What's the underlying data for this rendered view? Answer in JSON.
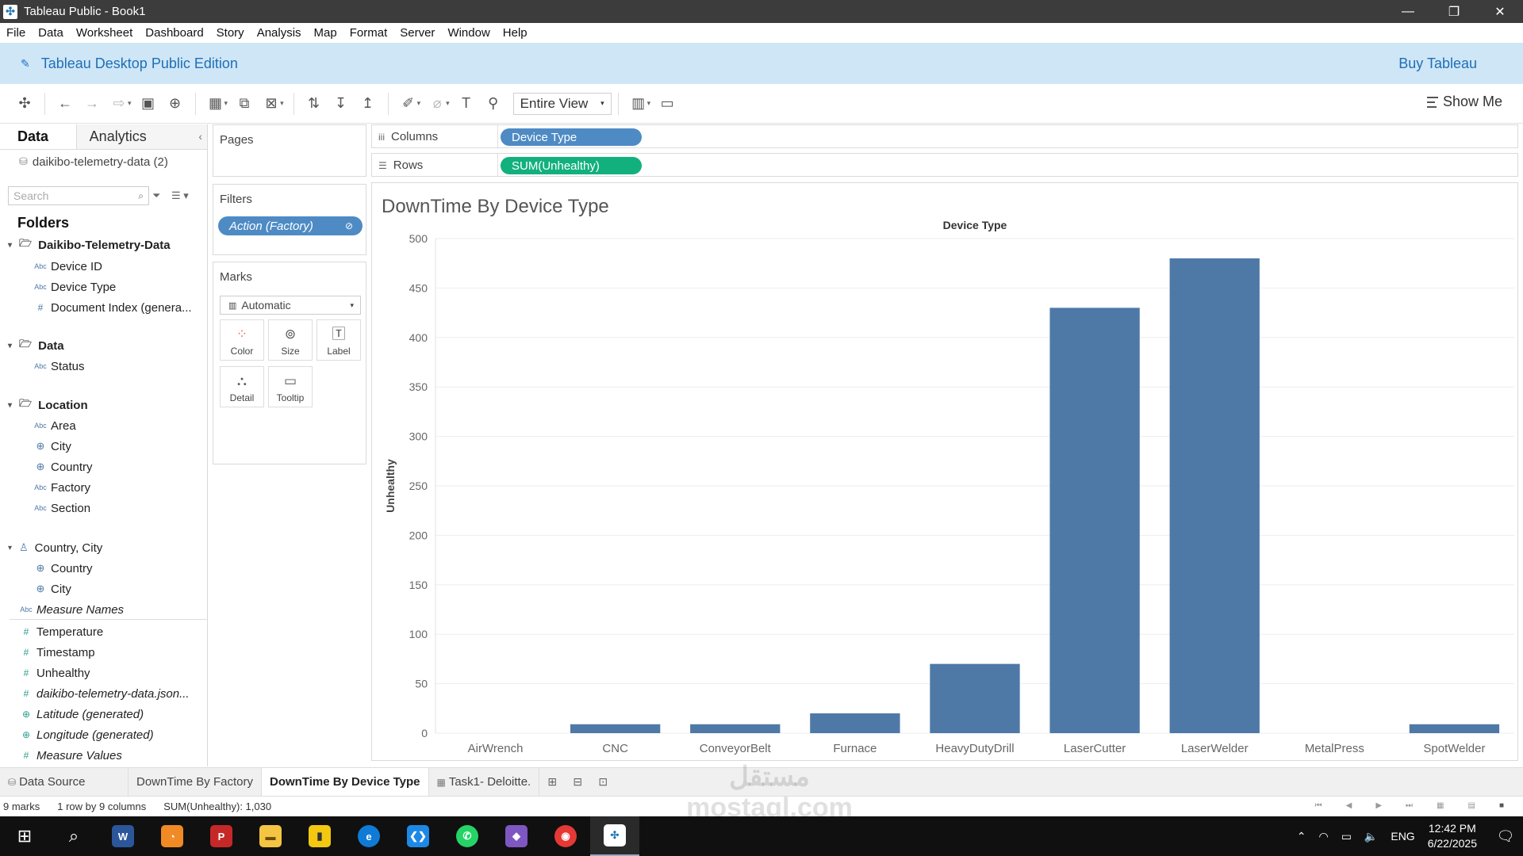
{
  "window": {
    "title": "Tableau Public - Book1",
    "controls": [
      "minimize-icon",
      "restore-icon",
      "close-icon"
    ]
  },
  "menu": [
    "File",
    "Data",
    "Worksheet",
    "Dashboard",
    "Story",
    "Analysis",
    "Map",
    "Format",
    "Server",
    "Window",
    "Help"
  ],
  "banner": {
    "edition": "Tableau Desktop Public Edition",
    "buy": "Buy Tableau"
  },
  "toolbar": {
    "fit": "Entire View",
    "show_me": "Show Me"
  },
  "data_pane": {
    "tabs": [
      "Data",
      "Analytics"
    ],
    "source": "daikibo-telemetry-data (2)",
    "search_placeholder": "Search",
    "folders_label": "Folders",
    "groups": [
      {
        "name": "Daikibo-Telemetry-Data",
        "fields": [
          {
            "type": "Abc",
            "name": "Device ID"
          },
          {
            "type": "Abc",
            "name": "Device Type"
          },
          {
            "type": "#",
            "name": "Document Index (genera..."
          }
        ]
      },
      {
        "name": "Data",
        "fields": [
          {
            "type": "Abc",
            "name": "Status"
          }
        ]
      },
      {
        "name": "Location",
        "fields": [
          {
            "type": "Abc",
            "name": "Area"
          },
          {
            "type": "geo",
            "name": "City"
          },
          {
            "type": "geo",
            "name": "Country"
          },
          {
            "type": "Abc",
            "name": "Factory"
          },
          {
            "type": "Abc",
            "name": "Section"
          }
        ]
      },
      {
        "name": "Country, City",
        "fields": [
          {
            "type": "geo",
            "name": "Country"
          },
          {
            "type": "geo",
            "name": "City"
          }
        ]
      }
    ],
    "measure_names": "Measure Names",
    "measures": [
      {
        "name": "Temperature",
        "italic": false
      },
      {
        "name": "Timestamp",
        "italic": false
      },
      {
        "name": "Unhealthy",
        "italic": false
      },
      {
        "name": "daikibo-telemetry-data.json...",
        "italic": true
      },
      {
        "name": "Latitude (generated)",
        "italic": true
      },
      {
        "name": "Longitude (generated)",
        "italic": true
      },
      {
        "name": "Measure Values",
        "italic": true
      }
    ]
  },
  "cards": {
    "pages": "Pages",
    "filters": "Filters",
    "filter_pill": "Action (Factory)",
    "marks": "Marks",
    "mark_type": "Automatic",
    "mark_buttons": [
      "Color",
      "Size",
      "Label",
      "Detail",
      "Tooltip"
    ]
  },
  "shelves": {
    "columns_label": "Columns",
    "rows_label": "Rows",
    "columns_pill": "Device Type",
    "rows_pill": "SUM(Unhealthy)"
  },
  "viz": {
    "title": "DownTime By Device Type"
  },
  "chart_data": {
    "type": "bar",
    "title": "DownTime By Device Type",
    "header": "Device Type",
    "xlabel": "Device Type",
    "ylabel": "Unhealthy",
    "categories": [
      "AirWrench",
      "CNC",
      "ConveyorBelt",
      "Furnace",
      "HeavyDutyDrill",
      "LaserCutter",
      "LaserWelder",
      "MetalPress",
      "SpotWelder"
    ],
    "values": [
      0,
      9,
      9,
      20,
      70,
      430,
      480,
      0,
      9
    ],
    "ylim": [
      0,
      500
    ],
    "yticks": [
      0,
      50,
      100,
      150,
      200,
      250,
      300,
      350,
      400,
      450,
      500
    ],
    "color": "#4e79a7",
    "grid": true
  },
  "sheet_tabs": [
    {
      "label": "Data Source",
      "icon": "database-icon",
      "active": false
    },
    {
      "label": "DownTime By Factory",
      "icon": "",
      "active": false
    },
    {
      "label": "DownTime By Device Type",
      "icon": "",
      "active": true
    },
    {
      "label": "Task1- Deloitte.",
      "icon": "dashboard-icon",
      "active": false
    }
  ],
  "status": {
    "marks": "9 marks",
    "dims": "1 row by 9 columns",
    "sum": "SUM(Unhealthy): 1,030"
  },
  "taskbar": {
    "language": "ENG",
    "time": "12:42 PM",
    "date": "6/22/2025"
  },
  "watermark": "mostaql.com"
}
